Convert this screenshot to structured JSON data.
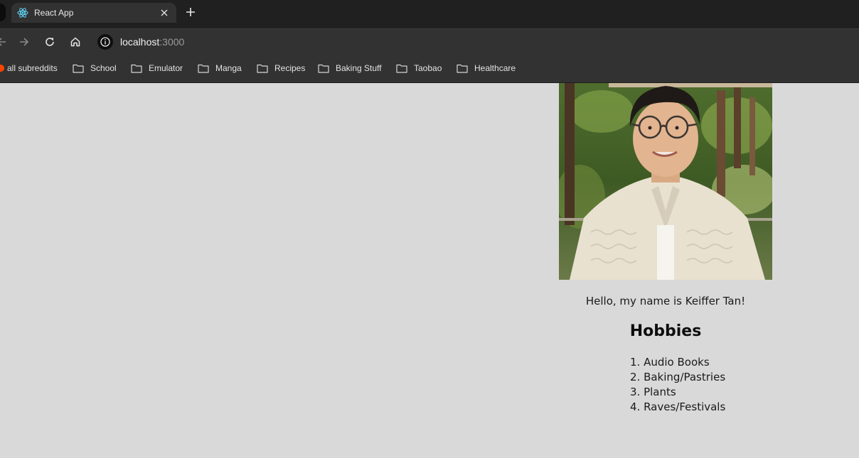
{
  "browser": {
    "tab": {
      "title": "React App",
      "favicon": "react-icon"
    },
    "address": {
      "host": "localhost",
      "port": ":3000"
    },
    "bookmarks": [
      {
        "label": "all subreddits",
        "icon": "reddit-icon"
      },
      {
        "label": "School",
        "icon": "folder-icon"
      },
      {
        "label": "Emulator",
        "icon": "folder-icon"
      },
      {
        "label": "Manga",
        "icon": "folder-icon"
      },
      {
        "label": "Recipes",
        "icon": "folder-icon"
      },
      {
        "label": "Baking Stuff",
        "icon": "folder-icon"
      },
      {
        "label": "Taobao",
        "icon": "folder-icon"
      },
      {
        "label": "Healthcare",
        "icon": "folder-icon"
      }
    ]
  },
  "page": {
    "greeting": "Hello, my name is Keiffer Tan!",
    "hobbies_title": "Hobbies",
    "hobbies": [
      "1. Audio Books",
      "2. Baking/Pastries",
      "3. Plants",
      "4. Raves/Festivals"
    ],
    "background": "#d9d9d9"
  }
}
